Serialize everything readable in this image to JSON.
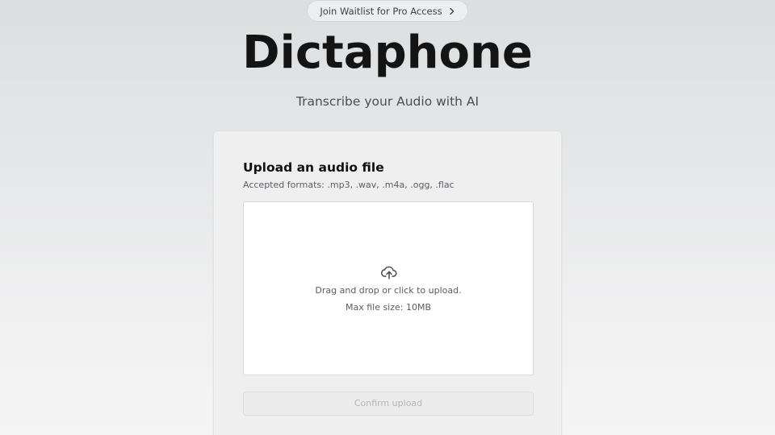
{
  "banner": {
    "waitlist_label": "Join Waitlist for Pro Access",
    "chevron_icon": "chevron-right-icon"
  },
  "header": {
    "title": "Dictaphone",
    "subtitle": "Transcribe your Audio with AI"
  },
  "upload_card": {
    "title": "Upload an audio file",
    "accepted_formats": "Accepted formats: .mp3, .wav, .m4a, .ogg, .flac",
    "dropzone": {
      "icon": "cloud-upload-icon",
      "instruction": "Drag and drop or click to upload.",
      "max_size": "Max file size: 10MB"
    },
    "confirm_label": "Confirm upload",
    "confirm_disabled": true
  },
  "colors": {
    "background_top": "#dcdedf",
    "background_bottom": "#f5f5f5",
    "card_bg": "#efefef",
    "dropzone_bg": "#ffffff",
    "title_text": "#141414",
    "muted_text": "#595c61",
    "disabled_text": "#b3b5b8"
  }
}
